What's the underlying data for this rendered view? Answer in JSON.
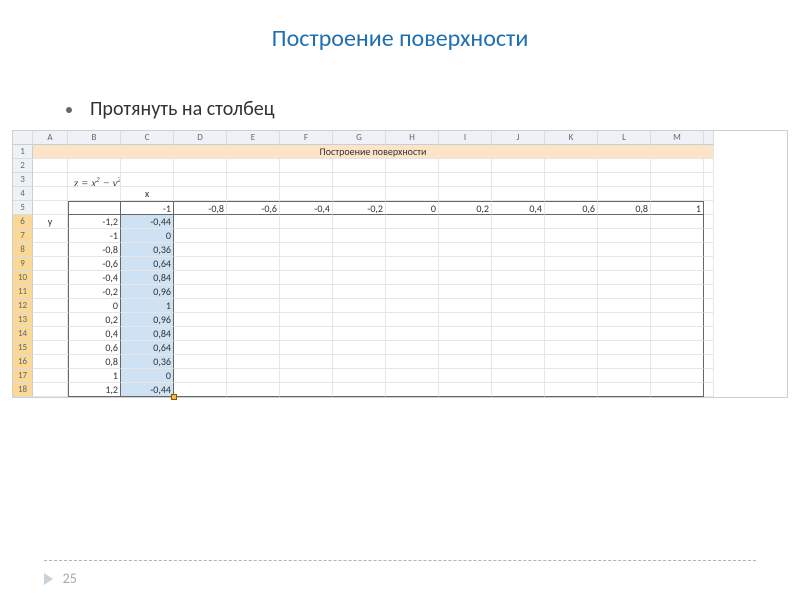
{
  "slide": {
    "title": "Построение поверхности",
    "bullet": "Протянуть на столбец",
    "page_number": "25"
  },
  "sheet": {
    "col_headers": [
      "A",
      "B",
      "C",
      "D",
      "E",
      "F",
      "G",
      "H",
      "I",
      "J",
      "K",
      "L",
      "M"
    ],
    "row_headers": [
      "1",
      "2",
      "3",
      "4",
      "5",
      "6",
      "7",
      "8",
      "9",
      "10",
      "11",
      "12",
      "13",
      "14",
      "15",
      "16",
      "17",
      "18"
    ],
    "selected_rows_start": 6,
    "selected_rows_end": 18,
    "merged_title": "Построение поверхности",
    "formula": "z = x² − y²",
    "x_label": "x",
    "y_label": "y",
    "row5": {
      "C": "-1",
      "D": "-0,8",
      "E": "-0,6",
      "F": "-0,4",
      "G": "-0,2",
      "H": "0",
      "I": "0,2",
      "J": "0,4",
      "K": "0,6",
      "L": "0,8",
      "M": "1"
    },
    "data_rows": [
      {
        "A": "y",
        "B": "-1,2",
        "C": "-0,44"
      },
      {
        "B": "-1",
        "C": "0"
      },
      {
        "B": "-0,8",
        "C": "0,36"
      },
      {
        "B": "-0,6",
        "C": "0,64"
      },
      {
        "B": "-0,4",
        "C": "0,84"
      },
      {
        "B": "-0,2",
        "C": "0,96"
      },
      {
        "B": "0",
        "C": "1"
      },
      {
        "B": "0,2",
        "C": "0,96"
      },
      {
        "B": "0,4",
        "C": "0,84"
      },
      {
        "B": "0,6",
        "C": "0,64"
      },
      {
        "B": "0,8",
        "C": "0,36"
      },
      {
        "B": "1",
        "C": "0"
      },
      {
        "B": "1,2",
        "C": "-0,44"
      }
    ]
  }
}
